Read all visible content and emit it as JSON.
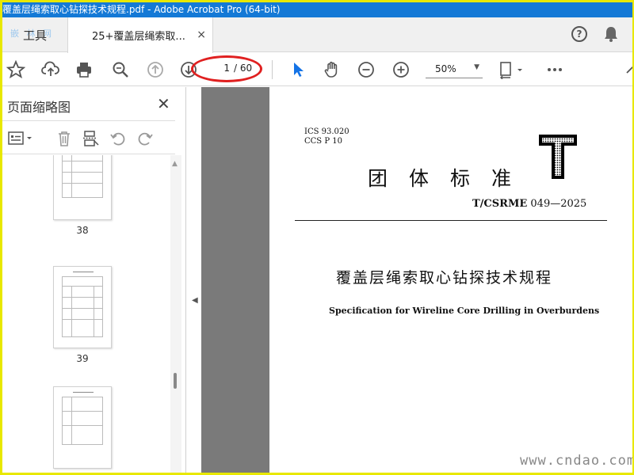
{
  "window": {
    "title": "覆盖层绳索取心钻探技术规程.pdf - Adobe Acrobat Pro (64-bit)",
    "watermark": "嵌 林 网"
  },
  "tabs": {
    "tools_label": "工具",
    "document_label": "25+覆盖层绳索取...",
    "close_glyph": "×"
  },
  "header_icons": [
    "help-icon",
    "bell-icon"
  ],
  "toolbar": {
    "icons": [
      "star-icon",
      "upload-icon",
      "print-icon",
      "zoom-search-icon",
      "page-up-icon",
      "page-down-icon",
      "select-cursor-icon",
      "hand-icon",
      "zoom-out-icon",
      "zoom-in-icon",
      "fit-page-icon",
      "more-icon"
    ],
    "page_current": "1",
    "page_total": "/ 60",
    "zoom": "50%"
  },
  "sidebar": {
    "title": "页面缩略图",
    "thumbnails": [
      {
        "label": "38"
      },
      {
        "label": "39"
      },
      {
        "label": ""
      }
    ]
  },
  "document": {
    "ics": "ICS 93.020",
    "ccs": "CCS P 10",
    "big_letter": "T",
    "standard_title": "团体标准",
    "standard_code_prefix": "T/CSRME",
    "standard_code_number": "049—2025",
    "title_cn": "覆盖层绳索取心钻探技术规程",
    "title_en": "Specification for Wireline Core Drilling in Overburdens"
  },
  "watermark": {
    "site": "www.cndao.com"
  },
  "colors": {
    "titlebar": "#1479d6",
    "border_frame": "#e8e800",
    "highlight_ring": "#e02020",
    "select_tool": "#1473e6",
    "doc_background": "#7a7a7a"
  }
}
